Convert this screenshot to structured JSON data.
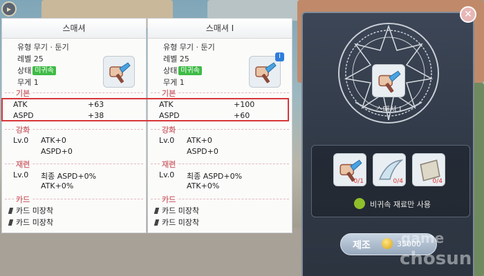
{
  "left_card": {
    "title": "스매셔",
    "type_line": "유형 무기 · 둔기",
    "level_line": "레벨 25",
    "state_label": "상태",
    "state_badge": "미귀속",
    "weight_line": "무게 1",
    "section_basic": "기본",
    "atk_label": "ATK",
    "atk_value": "+63",
    "aspd_label": "ASPD",
    "aspd_value": "+38",
    "section_enhance": "강화",
    "enh_level": "Lv.0",
    "enh_atk": "ATK+0",
    "enh_aspd": "ASPD+0",
    "section_refine": "재련",
    "ref_level": "Lv.0",
    "ref_final": "최종 ASPD+0%",
    "ref_atk": "ATK+0%",
    "section_card": "카드",
    "card_slot_1": "카드 미장착",
    "card_slot_2": "카드 미장착"
  },
  "right_card": {
    "title": "스매셔 I",
    "type_line": "유형 무기 · 둔기",
    "level_line": "레벨 25",
    "state_label": "상태",
    "state_badge": "미귀속",
    "weight_line": "무게 1",
    "new_badge": "I",
    "section_basic": "기본",
    "atk_label": "ATK",
    "atk_value": "+100",
    "aspd_label": "ASPD",
    "aspd_value": "+60",
    "section_enhance": "강화",
    "enh_level": "Lv.0",
    "enh_atk": "ATK+0",
    "enh_aspd": "ASPD+0",
    "section_refine": "재련",
    "ref_level": "Lv.0",
    "ref_final": "최종 ASPD+0%",
    "ref_atk": "ATK+0%",
    "section_card": "카드",
    "card_slot_1": "카드 미장착",
    "card_slot_2": "카드 미장착"
  },
  "craft": {
    "result_name": "스매셔 I",
    "materials": [
      {
        "icon": "smasher-hammer-icon",
        "count": "0/1"
      },
      {
        "icon": "claw-fang-icon",
        "count": "0/4"
      },
      {
        "icon": "cloth-scrap-icon",
        "count": "0/4"
      }
    ],
    "unbound_only_label": "비귀속 재료만 사용",
    "make_button_label": "제조",
    "cost": "35000",
    "watermark_top": "game",
    "watermark_bottom": "chosun"
  },
  "colors": {
    "badge_green": "#3fbb46",
    "section_pink": "#d1737a",
    "highlight_red": "#d8363a",
    "panel_dark": "#323b49"
  }
}
